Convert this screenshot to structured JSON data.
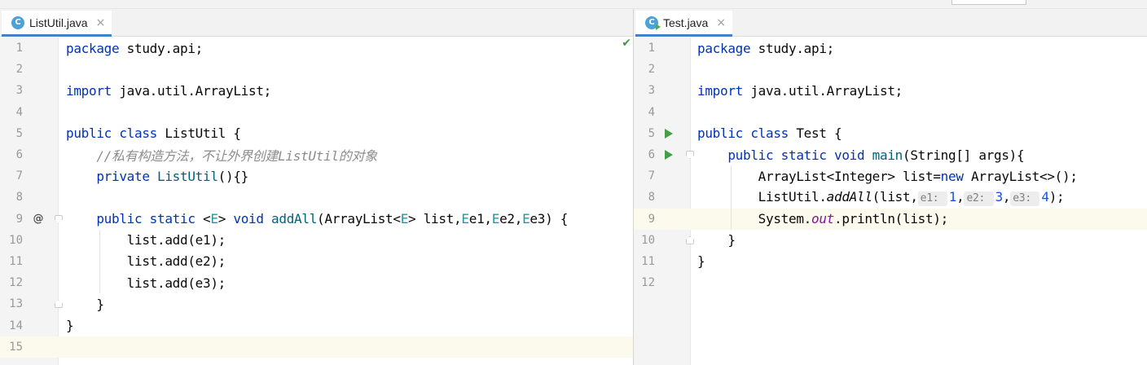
{
  "left_editor": {
    "tab": {
      "label": "ListUtil.java",
      "icon": "java-class-icon"
    },
    "status": "inspection-ok-check-icon",
    "lines": [
      {
        "n": "1",
        "code": [
          [
            "kw",
            "package"
          ],
          [
            "",
            "study.api;"
          ]
        ]
      },
      {
        "n": "2",
        "code": []
      },
      {
        "n": "3",
        "code": [
          [
            "kw",
            "import"
          ],
          [
            "",
            "java.util.ArrayList;"
          ]
        ]
      },
      {
        "n": "4",
        "code": []
      },
      {
        "n": "5",
        "code": [
          [
            "kw",
            "public class"
          ],
          [
            "",
            "ListUtil {"
          ]
        ]
      },
      {
        "n": "6",
        "code": [
          [
            "cm",
            "    //私有构造方法，不让外界创建ListUtil的对象"
          ]
        ]
      },
      {
        "n": "7",
        "code": [
          [
            "kw",
            "    private"
          ],
          [
            "fn",
            "ListUtil"
          ],
          [
            "",
            "(){}"
          ]
        ]
      },
      {
        "n": "8",
        "code": []
      },
      {
        "n": "9",
        "code": [
          [
            "kw",
            "    public static"
          ],
          [
            "",
            "<"
          ],
          [
            "tp",
            "E"
          ],
          [
            "",
            "> "
          ],
          [
            "kw",
            "void"
          ],
          [
            "fn",
            "addAll"
          ],
          [
            "",
            "(ArrayList<"
          ],
          [
            "tp",
            "E"
          ],
          [
            "",
            "> list,"
          ],
          [
            "tp",
            "E"
          ],
          [
            "",
            "e1,"
          ],
          [
            "tp",
            "E"
          ],
          [
            "",
            "e2,"
          ],
          [
            "tp",
            "E"
          ],
          [
            "",
            "e3) {"
          ]
        ]
      },
      {
        "n": "10",
        "code": [
          [
            "",
            "        list.add(e1);"
          ]
        ]
      },
      {
        "n": "11",
        "code": [
          [
            "",
            "        list.add(e2);"
          ]
        ]
      },
      {
        "n": "12",
        "code": [
          [
            "",
            "        list.add(e3);"
          ]
        ]
      },
      {
        "n": "13",
        "code": [
          [
            "",
            "    }"
          ]
        ]
      },
      {
        "n": "14",
        "code": [
          [
            "",
            "}"
          ]
        ]
      },
      {
        "n": "15",
        "code": []
      }
    ]
  },
  "right_editor": {
    "tab": {
      "label": "Test.java",
      "icon": "java-class-runnable-icon"
    },
    "lines": [
      {
        "n": "1",
        "code": [
          [
            "kw",
            "package"
          ],
          [
            "",
            "study.api;"
          ]
        ]
      },
      {
        "n": "2",
        "code": []
      },
      {
        "n": "3",
        "code": [
          [
            "kw",
            "import"
          ],
          [
            "",
            "java.util.ArrayList;"
          ]
        ]
      },
      {
        "n": "4",
        "code": []
      },
      {
        "n": "5",
        "code": [
          [
            "kw",
            "public class"
          ],
          [
            "",
            "Test {"
          ]
        ]
      },
      {
        "n": "6",
        "code": [
          [
            "kw",
            "    public static void"
          ],
          [
            "fn",
            "main"
          ],
          [
            "",
            "(String[] args){"
          ]
        ]
      },
      {
        "n": "7",
        "code": [
          [
            "",
            "        ArrayList<Integer> list="
          ],
          [
            "kw",
            "new"
          ],
          [
            "",
            "ArrayList<>();"
          ]
        ]
      },
      {
        "n": "8",
        "code": [
          [
            "",
            "        ListUtil."
          ],
          [
            "it",
            "addAll"
          ],
          [
            "",
            "(list,"
          ],
          [
            "hint",
            "e1:"
          ],
          [
            "num",
            "1"
          ],
          [
            "",
            ","
          ],
          [
            "hint",
            "e2:"
          ],
          [
            "num",
            "3"
          ],
          [
            "",
            ","
          ],
          [
            "hint",
            "e3:"
          ],
          [
            "num",
            "4"
          ],
          [
            "",
            ");"
          ]
        ]
      },
      {
        "n": "9",
        "code": [
          [
            "",
            "        System."
          ],
          [
            "st",
            "out"
          ],
          [
            "",
            ".println(list);"
          ]
        ]
      },
      {
        "n": "10",
        "code": [
          [
            "",
            "    }"
          ]
        ]
      },
      {
        "n": "11",
        "code": [
          [
            "",
            "}"
          ]
        ]
      },
      {
        "n": "12",
        "code": []
      }
    ]
  }
}
